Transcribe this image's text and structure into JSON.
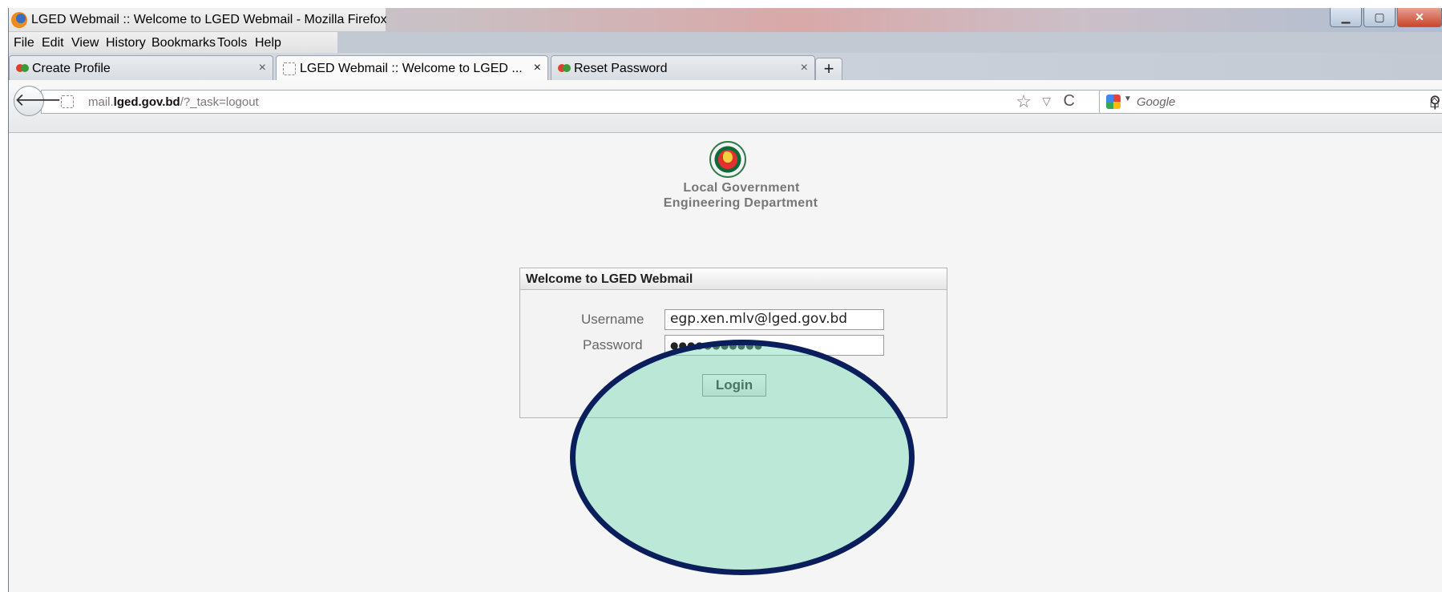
{
  "window": {
    "title": "LGED Webmail :: Welcome to LGED Webmail - Mozilla Firefox",
    "controls": {
      "minimize": "▁",
      "maximize": "▢",
      "close": "✕"
    }
  },
  "menu": {
    "items": [
      "File",
      "Edit",
      "View",
      "History",
      "Bookmarks",
      "Tools",
      "Help"
    ]
  },
  "tabs": [
    {
      "label": "Create Profile",
      "close": "×",
      "active": false
    },
    {
      "label": "LGED Webmail :: Welcome to LGED ...",
      "close": "×",
      "active": true
    },
    {
      "label": "Reset Password",
      "close": "×",
      "active": false
    }
  ],
  "newtab_label": "+",
  "nav": {
    "back": "🡐",
    "url_host_pre": "mail.",
    "url_host_bold": "lged.gov.bd",
    "url_path": "/?_task=logout",
    "star": "☆",
    "dropdown": "▽",
    "reload": "C",
    "search_placeholder": "Google",
    "search_button": "⚲",
    "home": "⌂"
  },
  "page": {
    "org_line1": "Local Government",
    "org_line2": "Engineering Department",
    "login_title": "Welcome to LGED Webmail",
    "username_label": "Username",
    "username_value": "egp.xen.mlv@lged.gov.bd",
    "password_label": "Password",
    "password_value": "●●●●●●●●●●●",
    "login_button": "Login"
  },
  "colors": {
    "highlight_border": "#0b1e5c",
    "highlight_fill": "#78dcb4"
  }
}
